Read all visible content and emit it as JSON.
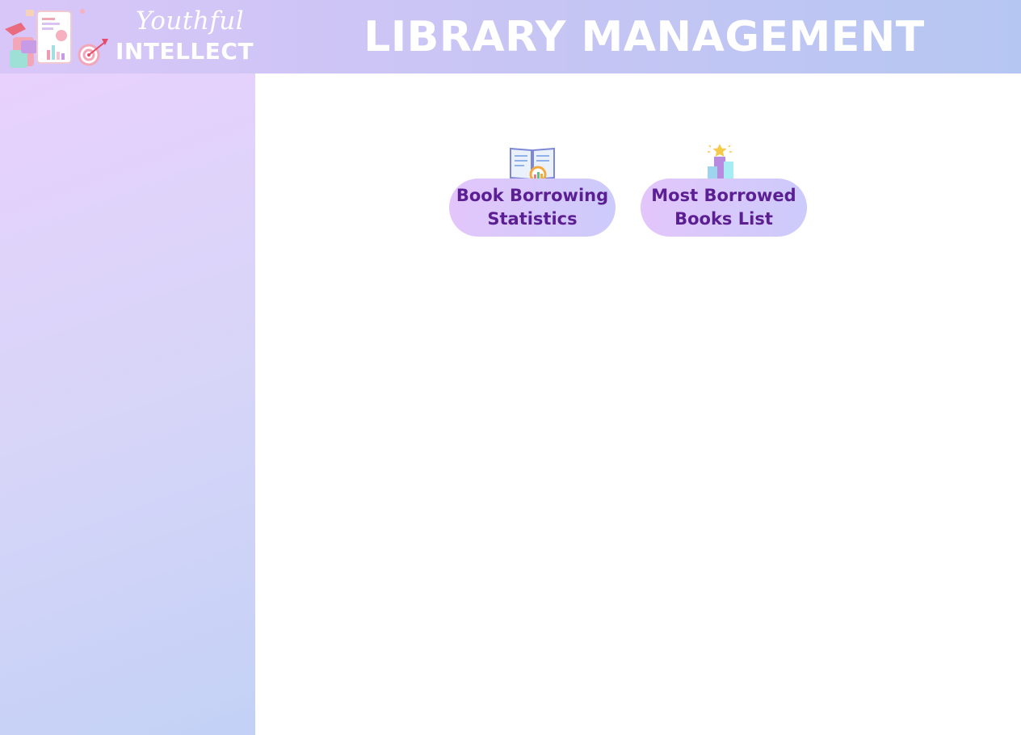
{
  "brand": {
    "script_text": "Youthful",
    "bold_text": "INTELLECT",
    "logo_icon": "analytics-illustration-icon"
  },
  "header": {
    "title": "LIBRARY MANAGEMENT"
  },
  "colors": {
    "header_gradient_start": "#d9c6f8",
    "header_gradient_end": "#b6c6f2",
    "sidebar_gradient_start": "#e8d1fd",
    "sidebar_gradient_end": "#c3d1f6",
    "button_text": "#5b1f93",
    "button_gradient_start": "#e3c6fb",
    "button_gradient_end": "#cccbfb"
  },
  "main": {
    "tiles": [
      {
        "label": "Book Borrowing\nStatistics",
        "icon": "book-search-chart-icon"
      },
      {
        "label": "Most Borrowed\nBooks List",
        "icon": "ranking-podium-star-icon"
      }
    ]
  }
}
